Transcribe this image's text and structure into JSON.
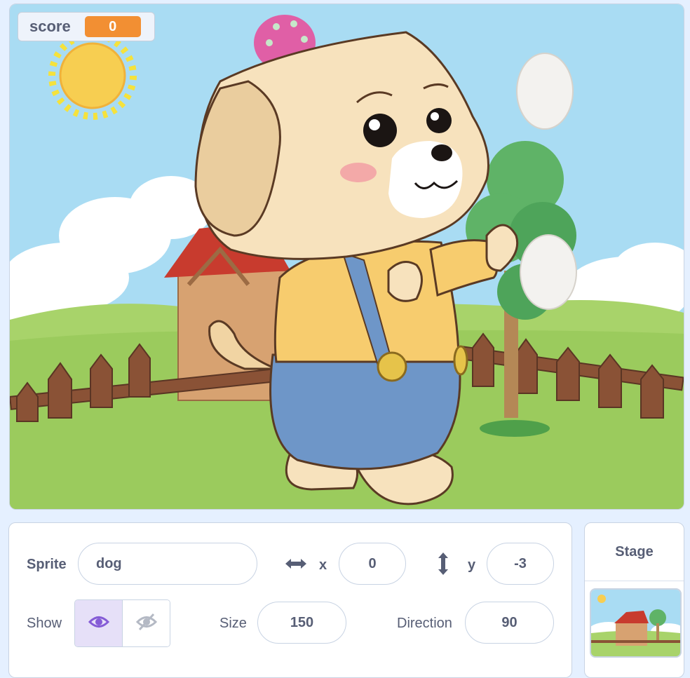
{
  "monitor": {
    "label": "score",
    "value": "0"
  },
  "sprite_info": {
    "sprite_label": "Sprite",
    "sprite_name": "dog",
    "x_label": "x",
    "x_value": "0",
    "y_label": "y",
    "y_value": "-3",
    "show_label": "Show",
    "size_label": "Size",
    "size_value": "150",
    "direction_label": "Direction",
    "direction_value": "90"
  },
  "stage_panel": {
    "title": "Stage"
  },
  "colors": {
    "sky": "#a9dcf3",
    "grass": "#a8d36a",
    "monitor_value": "#f28f33",
    "accent": "#855cd6"
  }
}
